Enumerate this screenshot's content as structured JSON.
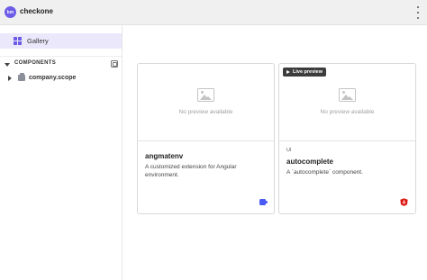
{
  "topbar": {
    "avatar_initials": "km",
    "title": "checkone",
    "menu_icon": "kebab-menu-icon"
  },
  "sidebar": {
    "gallery_label": "Gallery",
    "gallery_icon": "grid-icon",
    "components_header": "COMPONENTS",
    "scope_label": "company.scope"
  },
  "cards": [
    {
      "preview_text": "No preview available",
      "live_preview": false,
      "name": "angmatenv",
      "description": "A customized extension for Angular environment.",
      "env_icon": "env-icon"
    },
    {
      "preview_text": "No preview available",
      "live_preview": true,
      "live_label": "Live preview",
      "tag": "UI",
      "name": "autocomplete",
      "description": "A `autocomplete` component.",
      "env_icon": "angular-icon"
    }
  ],
  "colors": {
    "accent": "#6c5ce7",
    "selected_bg": "#ebe8fb",
    "angular_red": "#dd1b16",
    "env_blue": "#4a5bf5"
  }
}
